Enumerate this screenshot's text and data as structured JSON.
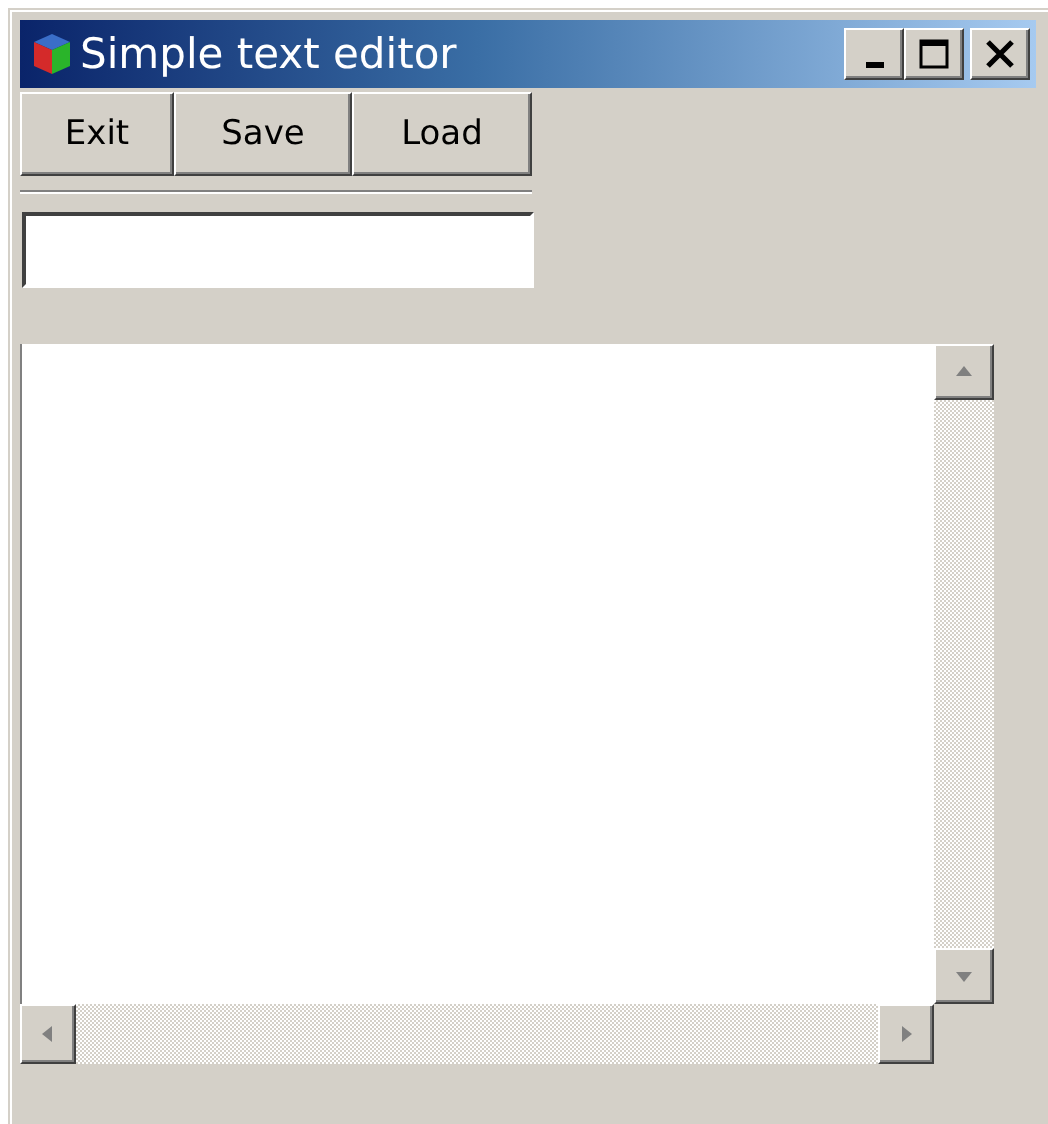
{
  "window": {
    "title": "Simple text editor"
  },
  "toolbar": {
    "buttons": [
      {
        "label": "Exit"
      },
      {
        "label": "Save"
      },
      {
        "label": "Load"
      }
    ]
  }
}
